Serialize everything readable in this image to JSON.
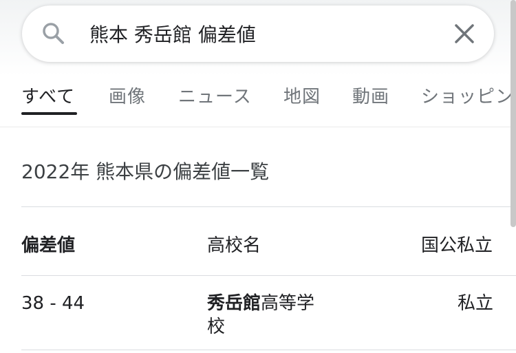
{
  "search": {
    "query": "熊本 秀岳館 偏差値"
  },
  "tabs": [
    {
      "label": "すべて",
      "active": true
    },
    {
      "label": "画像"
    },
    {
      "label": "ニュース"
    },
    {
      "label": "地図"
    },
    {
      "label": "動画"
    },
    {
      "label": "ショッピン"
    }
  ],
  "result": {
    "title": "2022年 熊本県の偏差値一覧",
    "table": {
      "headers": [
        "偏差値",
        "高校名",
        "国公私立"
      ],
      "rows": [
        {
          "score": "38 - 44",
          "name_bold": "秀岳館",
          "name_rest_line1": "高等学",
          "name_rest_line2": "校",
          "type": "私立"
        }
      ]
    }
  },
  "colors": {
    "text_primary": "#202124",
    "text_secondary": "#70757a",
    "divider": "#dadce0"
  },
  "icons": {
    "search": "search-icon",
    "clear": "close-icon"
  }
}
